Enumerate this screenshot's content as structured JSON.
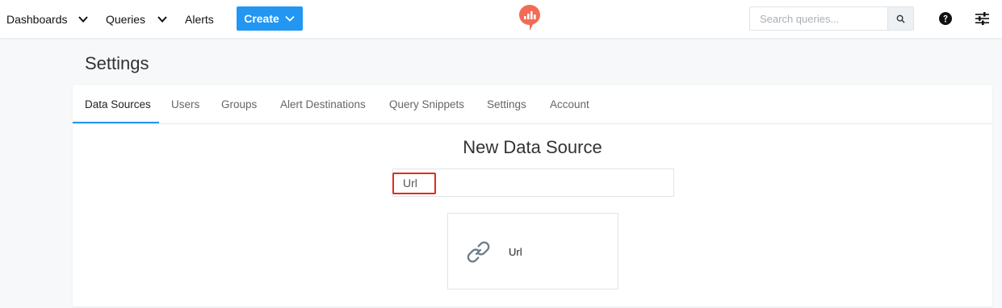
{
  "nav": {
    "dashboards_label": "Dashboards",
    "queries_label": "Queries",
    "alerts_label": "Alerts",
    "create_label": "Create",
    "search_placeholder": "Search queries...",
    "logo_color": "#f26b55",
    "accent": "#2196f3"
  },
  "page": {
    "title": "Settings"
  },
  "tabs": [
    {
      "label": "Data Sources",
      "active": true
    },
    {
      "label": "Users"
    },
    {
      "label": "Groups"
    },
    {
      "label": "Alert Destinations"
    },
    {
      "label": "Query Snippets"
    },
    {
      "label": "Settings"
    },
    {
      "label": "Account"
    }
  ],
  "content": {
    "title": "New Data Source",
    "filter_value": "Url",
    "results": [
      {
        "label": "Url",
        "icon": "link-icon"
      }
    ]
  }
}
